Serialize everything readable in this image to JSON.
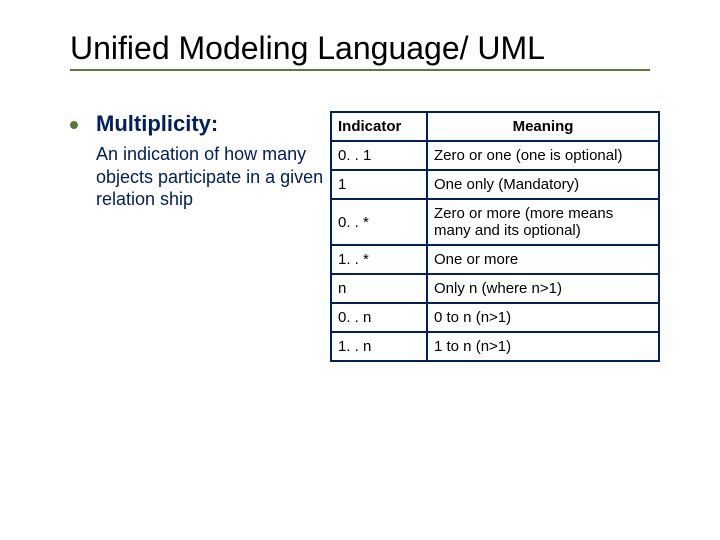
{
  "title": "Unified Modeling Language/ UML",
  "left": {
    "heading": "Multiplicity:",
    "description": "An indication of how many objects participate in a given relation ship"
  },
  "table": {
    "headers": {
      "indicator": "Indicator",
      "meaning": "Meaning"
    },
    "rows": [
      {
        "indicator": "0. . 1",
        "meaning": "Zero or one (one is optional)"
      },
      {
        "indicator": "1",
        "meaning": "One only (Mandatory)"
      },
      {
        "indicator": "0. . *",
        "meaning": "Zero or more (more means many and its optional)"
      },
      {
        "indicator": "1. . *",
        "meaning": "One or more"
      },
      {
        "indicator": "n",
        "meaning": "Only n (where n>1)"
      },
      {
        "indicator": "0. . n",
        "meaning": "0 to n (n>1)"
      },
      {
        "indicator": "1. . n",
        "meaning": "1 to n (n>1)"
      }
    ]
  }
}
